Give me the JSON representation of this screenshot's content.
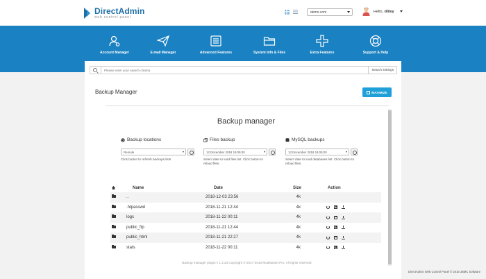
{
  "header": {
    "logo_title": "DirectAdmin",
    "logo_subtitle": "web control panel",
    "domain_value": "demo.com",
    "hello_prefix": "Hello,",
    "username": "diilsy"
  },
  "nav": [
    {
      "label": "Account Manager",
      "icon": "user-gear-icon"
    },
    {
      "label": "E-mail Manager",
      "icon": "paper-plane-icon"
    },
    {
      "label": "Advanced Features",
      "icon": "list-icon"
    },
    {
      "label": "System Info & Files",
      "icon": "folder-icon"
    },
    {
      "label": "Extra Features",
      "icon": "plus-icon"
    },
    {
      "label": "Support & Help",
      "icon": "lifebuoy-icon"
    }
  ],
  "search": {
    "placeholder": "Please enter your search criteria",
    "settings_label": "Search settings"
  },
  "page": {
    "title": "Backup Manager",
    "maximize_label": "MAXIMIZE"
  },
  "content": {
    "title": "Backup manager",
    "columns": {
      "locations": {
        "heading": "Backup locations",
        "value": "Remote",
        "hint": "Click button to refresh backups lists"
      },
      "files": {
        "heading": "Files backup",
        "value": "12 December 2018 19:05:00",
        "hint": "Select date to load files list. Click button to reload files."
      },
      "mysql": {
        "heading": "MySQL backups",
        "value": "12 December 2018 19:05:00",
        "hint": "Select date to load databases list. Click button to reload files."
      }
    },
    "table": {
      "headers": {
        "name": "Name",
        "date": "Date",
        "size": "Size",
        "action": "Action"
      },
      "rows": [
        {
          "name": "..",
          "date": "2018-12-03 23:56",
          "size": "4k",
          "actions": false
        },
        {
          "name": ".htpasswd",
          "date": "2018-11-21 12:44",
          "size": "4k",
          "actions": true
        },
        {
          "name": "logs",
          "date": "2018-11-22 00:11",
          "size": "4k",
          "actions": true
        },
        {
          "name": "public_ftp",
          "date": "2018-11-21 12:44",
          "size": "4k",
          "actions": true
        },
        {
          "name": "public_html",
          "date": "2018-11-21 22:27",
          "size": "4k",
          "actions": true
        },
        {
          "name": "stats",
          "date": "2018-11-22 00:11",
          "size": "4k",
          "actions": true
        }
      ]
    },
    "plugin_footer": "Backup manager plugin v 1.2.23 Copyright © 2017-2018 ModMaster.Pro. All rights reserved."
  },
  "footer": {
    "copyright": "DirectAdmin Web Control Panel © 2018 JBMC Software"
  },
  "colors": {
    "brand": "#1a81c2",
    "accent": "#1fa0d8"
  }
}
